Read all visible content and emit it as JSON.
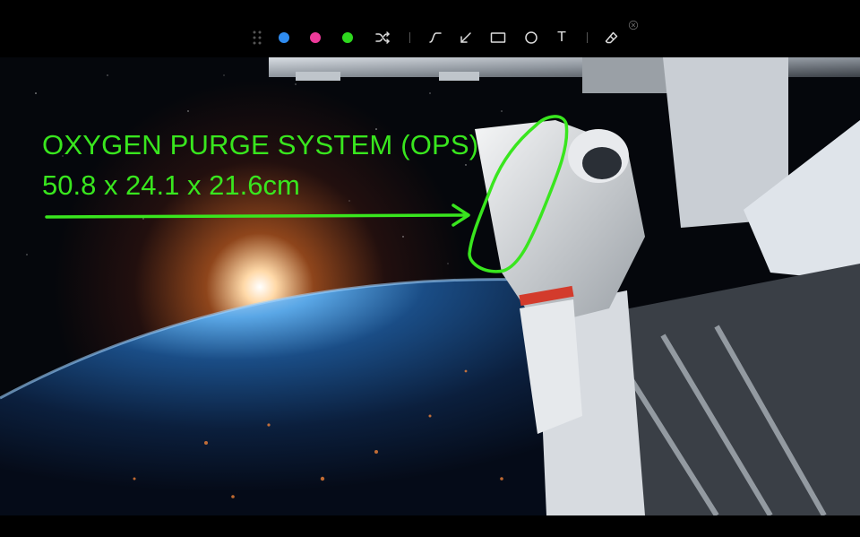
{
  "toolbar": {
    "colors": [
      {
        "name": "blue",
        "hex": "#2f8cf0"
      },
      {
        "name": "pink",
        "hex": "#ee3a9a"
      },
      {
        "name": "green",
        "hex": "#2ed81e"
      }
    ],
    "tools": [
      "shuffle-icon",
      "curve-icon",
      "arrow-icon",
      "rectangle-icon",
      "circle-icon",
      "text-icon",
      "eraser-icon"
    ],
    "text_tool_label": "T",
    "close_symbol": "×"
  },
  "annotation": {
    "title": "OXYGEN PURGE SYSTEM (OPS)",
    "dimensions": "50.8 x 24.1 x 21.6cm",
    "color": "#39e61e"
  }
}
